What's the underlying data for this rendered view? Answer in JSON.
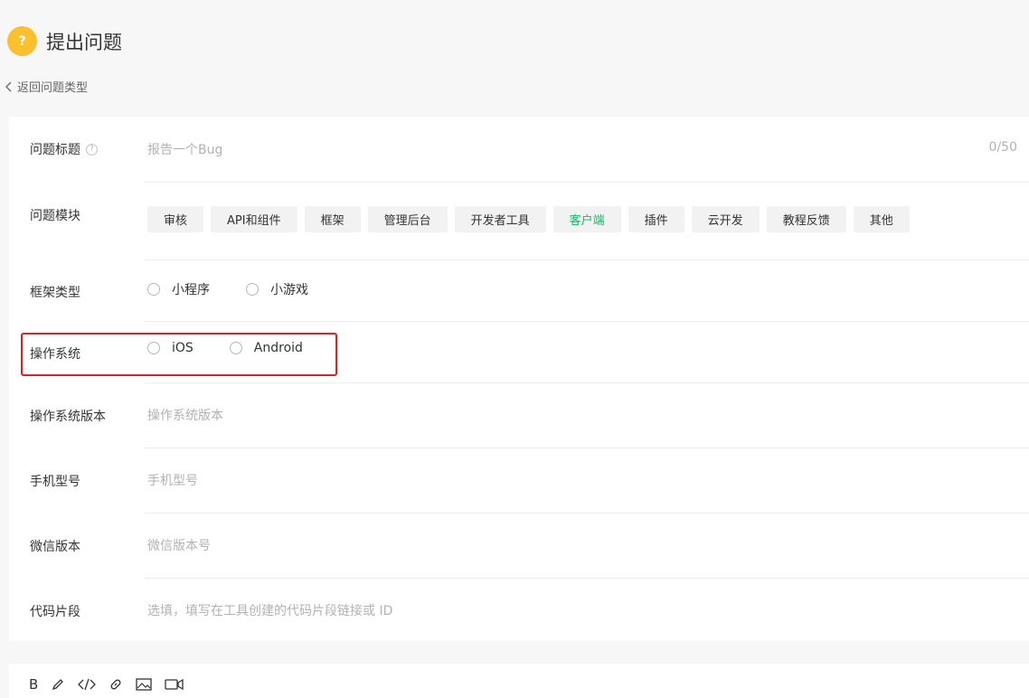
{
  "header": {
    "badge_icon": "question-icon",
    "badge_text": "?",
    "title": "提出问题"
  },
  "back_link": {
    "label": "返回问题类型"
  },
  "form": {
    "title_row": {
      "label": "问题标题",
      "placeholder": "报告一个Bug",
      "counter": "0/50"
    },
    "module_row": {
      "label": "问题模块",
      "tags": [
        "审核",
        "API和组件",
        "框架",
        "管理后台",
        "开发者工具",
        "客户端",
        "插件",
        "云开发",
        "教程反馈",
        "其他"
      ],
      "active_tag": "客户端"
    },
    "framework_row": {
      "label": "框架类型",
      "options": [
        "小程序",
        "小游戏"
      ]
    },
    "os_row": {
      "label": "操作系统",
      "options": [
        "iOS",
        "Android"
      ]
    },
    "os_version_row": {
      "label": "操作系统版本",
      "placeholder": "操作系统版本"
    },
    "phone_row": {
      "label": "手机型号",
      "placeholder": "手机型号"
    },
    "wechat_row": {
      "label": "微信版本",
      "placeholder": "微信版本号"
    },
    "code_row": {
      "label": "代码片段",
      "placeholder": "选填，填写在工具创建的代码片段链接或 ID"
    }
  },
  "toolbar": {
    "bold_label": "B"
  },
  "colors": {
    "accent": "#07c160",
    "badge": "#fbc02d",
    "highlight": "#e02020"
  }
}
